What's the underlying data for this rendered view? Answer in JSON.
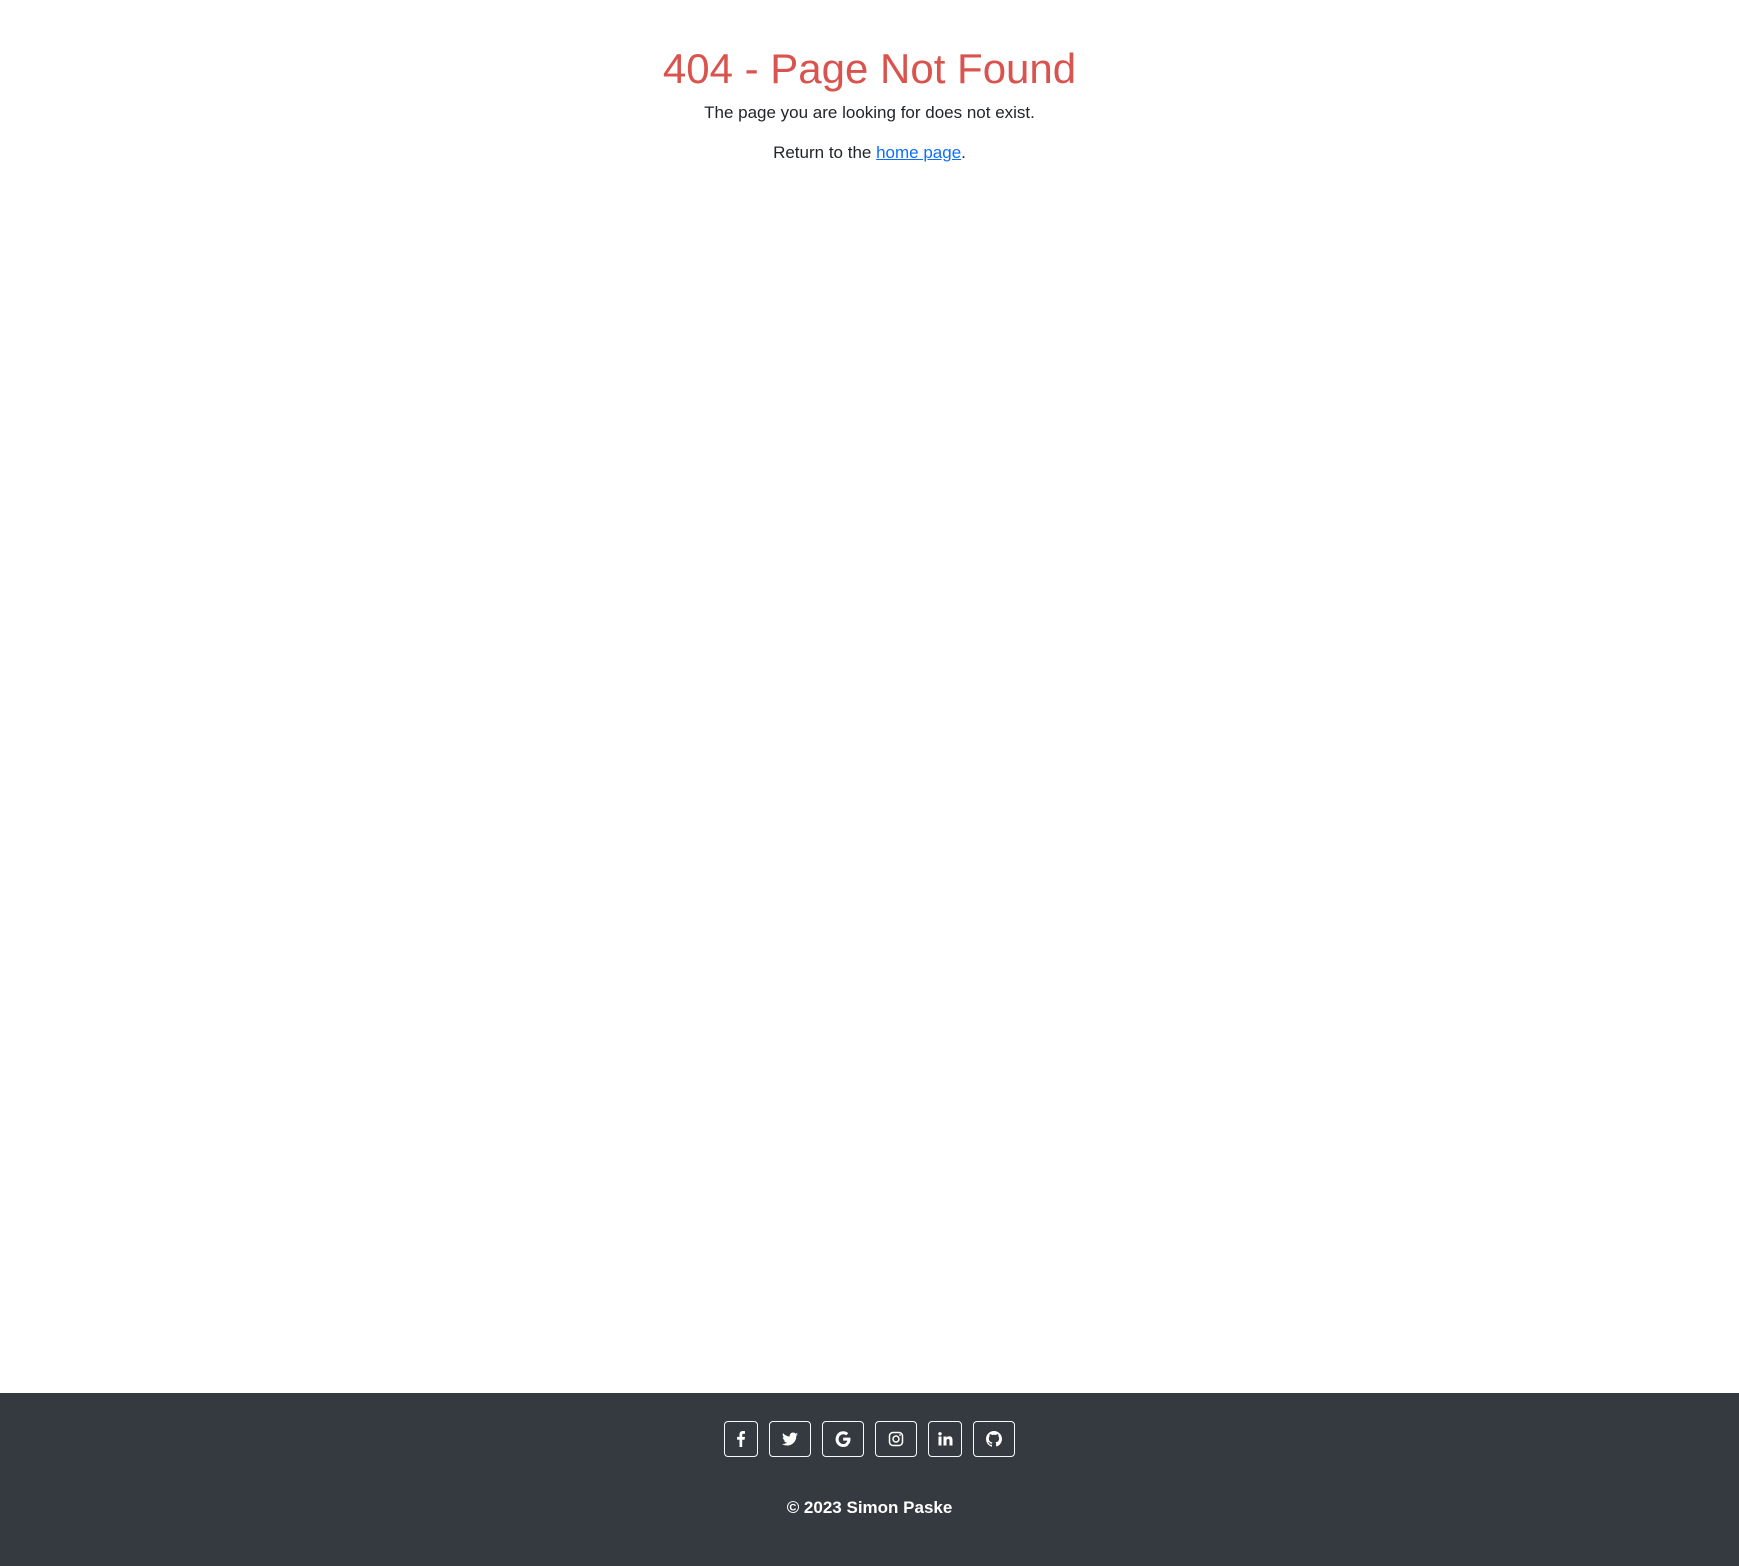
{
  "main": {
    "title": "404 - Page Not Found",
    "subtitle": "The page you are looking for does not exist.",
    "return_prefix": "Return to the ",
    "return_link": "home page",
    "return_suffix": "."
  },
  "footer": {
    "social_icons": [
      "facebook-icon",
      "twitter-icon",
      "google-icon",
      "instagram-icon",
      "linkedin-icon",
      "github-icon"
    ],
    "copyright": "© 2023 Simon Paske"
  },
  "colors": {
    "title": "#d9534f",
    "link": "#0d6efd",
    "footer_bg": "#343a40",
    "text": "#212529"
  }
}
